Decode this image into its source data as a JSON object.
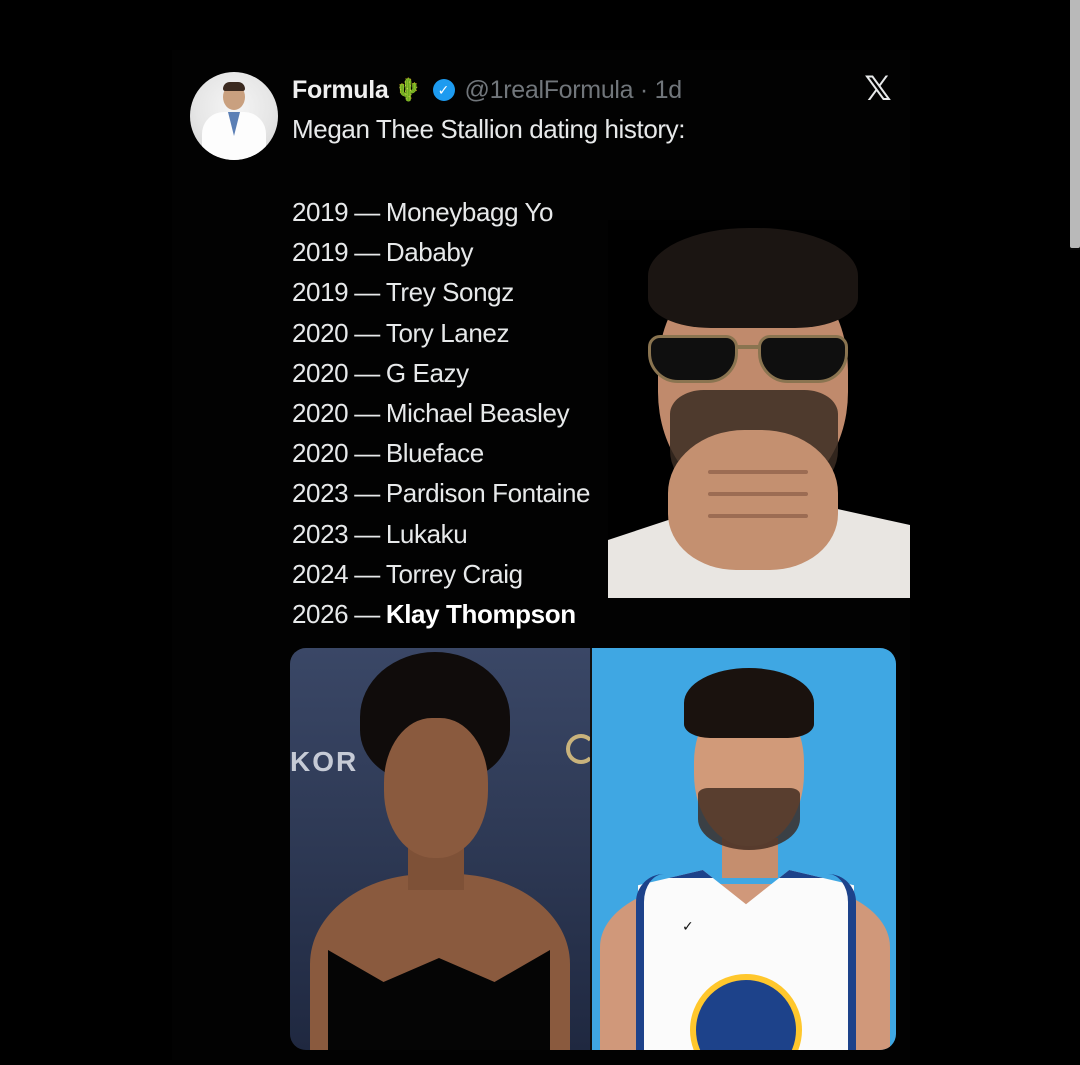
{
  "tweet": {
    "author_name": "Formula",
    "cactus_icon": "cactus-icon",
    "verified_icon": "verified-badge-icon",
    "handle": "@1realFormula · 1d",
    "platform_icon": "x-logo-icon",
    "text": "Megan Thee Stallion dating history:",
    "entries": [
      {
        "year": "2019",
        "sep": "—",
        "name": "Moneybagg Yo"
      },
      {
        "year": "2019",
        "sep": "—",
        "name": "Dababy"
      },
      {
        "year": "2019",
        "sep": "—",
        "name": "Trey Songz"
      },
      {
        "year": "2020",
        "sep": "—",
        "name": "Tory Lanez"
      },
      {
        "year": "2020",
        "sep": "—",
        "name": "G Eazy"
      },
      {
        "year": "2020",
        "sep": "—",
        "name": "Michael Beasley"
      },
      {
        "year": "2020",
        "sep": "—",
        "name": "Blueface"
      },
      {
        "year": "2023",
        "sep": "—",
        "name": "Pardison Fontaine"
      },
      {
        "year": "2023",
        "sep": "—",
        "name": "Lukaku"
      },
      {
        "year": "2024",
        "sep": "—",
        "name": "Torrey Craig"
      },
      {
        "year": "2026",
        "sep": "—",
        "name": "Klay Thompson"
      }
    ],
    "photo_left_sign": "KOR"
  },
  "colors": {
    "background": "#000000",
    "text": "#e7e9ea",
    "muted": "#71767b",
    "verified_blue": "#1d9bf0",
    "photo_right_bg": "#3fa7e3",
    "jersey_blue": "#1d428a",
    "jersey_gold": "#ffc72c"
  }
}
